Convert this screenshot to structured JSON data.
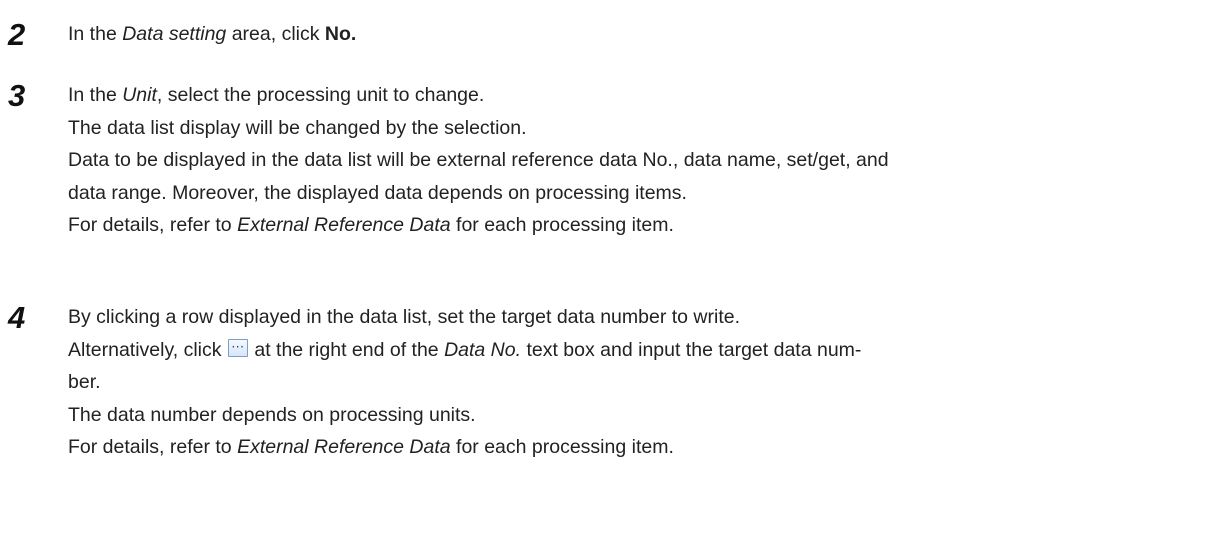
{
  "steps": [
    {
      "number": "2",
      "line1": {
        "a": "In the ",
        "b": "Data setting",
        "c": " area, click ",
        "d": "No."
      }
    },
    {
      "number": "3",
      "line1": {
        "a": "In the ",
        "b": "Unit",
        "c": ", select the processing unit to change."
      },
      "line2": "The data list display will be changed by the selection.",
      "line3": "Data to be displayed in the data list will be external reference data No., data name, set/get, and",
      "line4": "data range. Moreover, the displayed data depends on processing items.",
      "line5": {
        "a": "For details, refer to ",
        "b": "External Reference Data",
        "c": " for each processing item."
      }
    },
    {
      "number": "4",
      "line1": "By clicking a row displayed in the data list, set the target data number to write.",
      "line2": {
        "a": "Alternatively, click ",
        "icon": "ellipsis-button-icon",
        "b": " at the right end of the ",
        "c": "Data No.",
        "d": " text box and input the target data num-"
      },
      "line3": "ber.",
      "line4": "The data number depends on processing units.",
      "line5": {
        "a": "For details, refer to ",
        "b": "External Reference Data",
        "c": " for each processing item."
      }
    }
  ]
}
